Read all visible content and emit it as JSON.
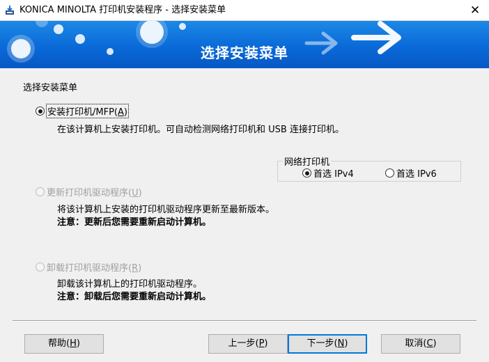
{
  "window": {
    "title": "KONICA MINOLTA 打印机安装程序 - 选择安装菜单",
    "close_symbol": "✕"
  },
  "banner": {
    "title": "选择安装菜单"
  },
  "section_label": "选择安装菜单",
  "options": [
    {
      "label": "安装打印机/MFP(",
      "accel": "A",
      "suffix": ")",
      "checked": true,
      "enabled": true,
      "desc": "在该计算机上安装打印机。可自动检测网络打印机和 USB 连接打印机。"
    },
    {
      "label": "更新打印机驱动程序(",
      "accel": "U",
      "suffix": ")",
      "checked": false,
      "enabled": false,
      "desc": "将该计算机上安装的打印机驱动程序更新至最新版本。",
      "note": "注意：更新后您需要重新启动计算机。"
    },
    {
      "label": "卸载打印机驱动程序(",
      "accel": "R",
      "suffix": ")",
      "checked": false,
      "enabled": false,
      "desc": "卸载该计算机上的打印机驱动程序。",
      "note": "注意：卸载后您需要重新启动计算机。"
    }
  ],
  "network_group": {
    "label": "网络打印机",
    "ipv4": {
      "label": "首选 IPv4",
      "checked": true
    },
    "ipv6": {
      "label": "首选 IPv6",
      "checked": false
    }
  },
  "buttons": {
    "help": {
      "label": "帮助(",
      "accel": "H",
      "suffix": ")"
    },
    "back": {
      "label": "上一步(",
      "accel": "P",
      "suffix": ")"
    },
    "next": {
      "label": "下一步(",
      "accel": "N",
      "suffix": ")"
    },
    "cancel": {
      "label": "取消(",
      "accel": "C",
      "suffix": ")"
    }
  },
  "colors": {
    "banner_blue": "#0a6ad8",
    "default_button_border": "#0078d7",
    "disabled_text": "#a0a0a0"
  },
  "icons": {
    "app": "printer-download-icon",
    "banner_decor": "arrow-right-icon"
  }
}
